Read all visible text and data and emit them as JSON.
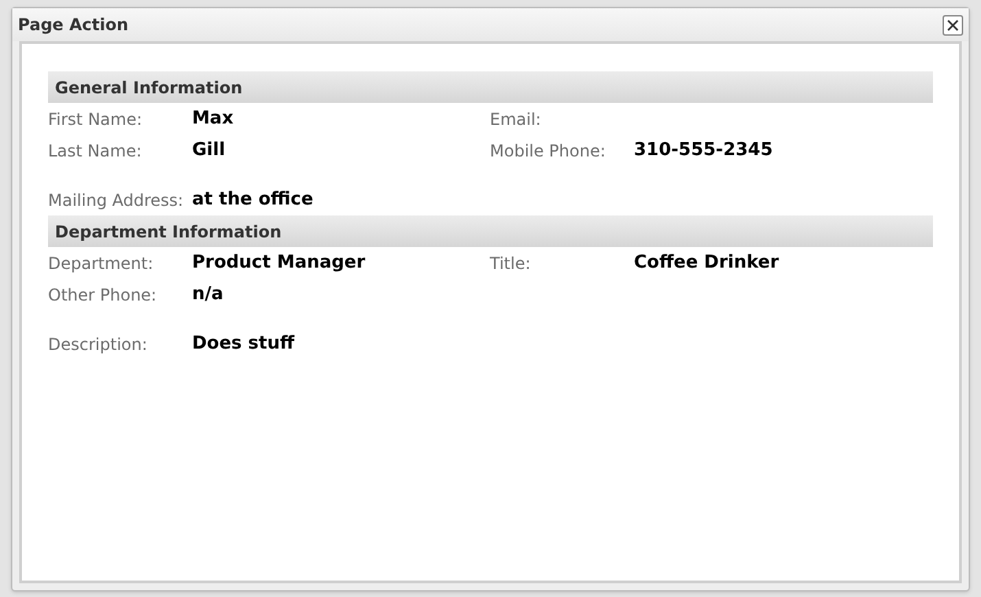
{
  "window": {
    "title": "Page Action"
  },
  "sections": [
    {
      "title": "General Information",
      "rows": [
        [
          {
            "label": "First Name:",
            "value": "Max"
          },
          {
            "label": "Email:"
          }
        ],
        [
          {
            "label": "Last Name:",
            "value": "Gill"
          },
          {
            "label": "Mobile Phone:",
            "value": "310-555-2345"
          }
        ],
        [
          {
            "label": "Mailing Address:",
            "value": "at the office"
          }
        ]
      ]
    },
    {
      "title": "Department Information",
      "rows": [
        [
          {
            "label": "Department:",
            "value": "Product Manager"
          },
          {
            "label": "Title:",
            "value": "Coffee Drinker"
          }
        ],
        [
          {
            "label": "Other Phone:",
            "value": "n/a"
          }
        ],
        [
          {
            "label": "Description:",
            "value": "Does stuff"
          }
        ]
      ]
    }
  ]
}
